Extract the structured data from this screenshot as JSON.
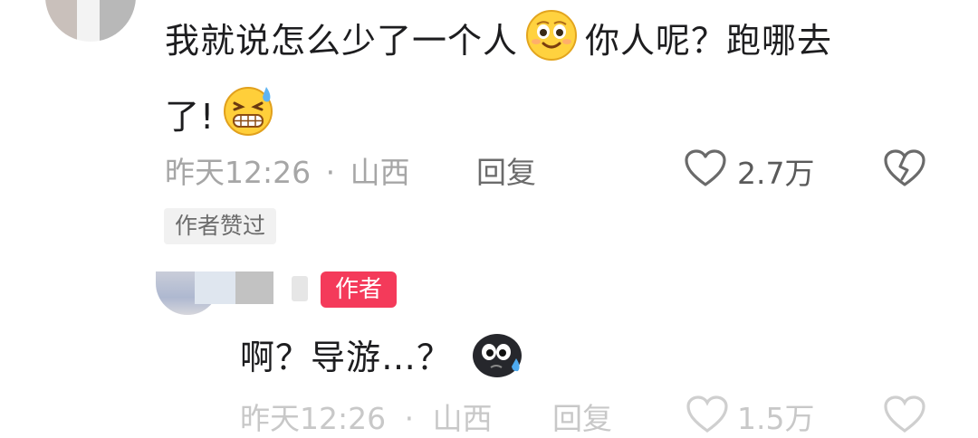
{
  "comment": {
    "text_part1": "我就说怎么少了一个人",
    "text_part2": "你人呢？跑哪去",
    "text_part3": "了!",
    "emoji_1": "smiling-face-emoji",
    "emoji_2": "grimacing-sweat-emoji",
    "time": "昨天12:26",
    "separator": "·",
    "location": "山西",
    "reply_label": "回复",
    "like_count": "2.7万",
    "author_liked_label": "作者赞过"
  },
  "reply": {
    "author_badge": "作者",
    "text": "啊？导游…？",
    "emoji": "dark-sweat-face-emoji",
    "time_partial": "昨天12:26",
    "location_partial": "山西",
    "reply_label_partial": "回复",
    "like_count_partial": "1.5万"
  },
  "colors": {
    "text": "#1d1d1f",
    "meta": "#a6a6a6",
    "author_badge_bg": "#f43a5a",
    "liked_badge_bg": "#f1f1f1"
  }
}
